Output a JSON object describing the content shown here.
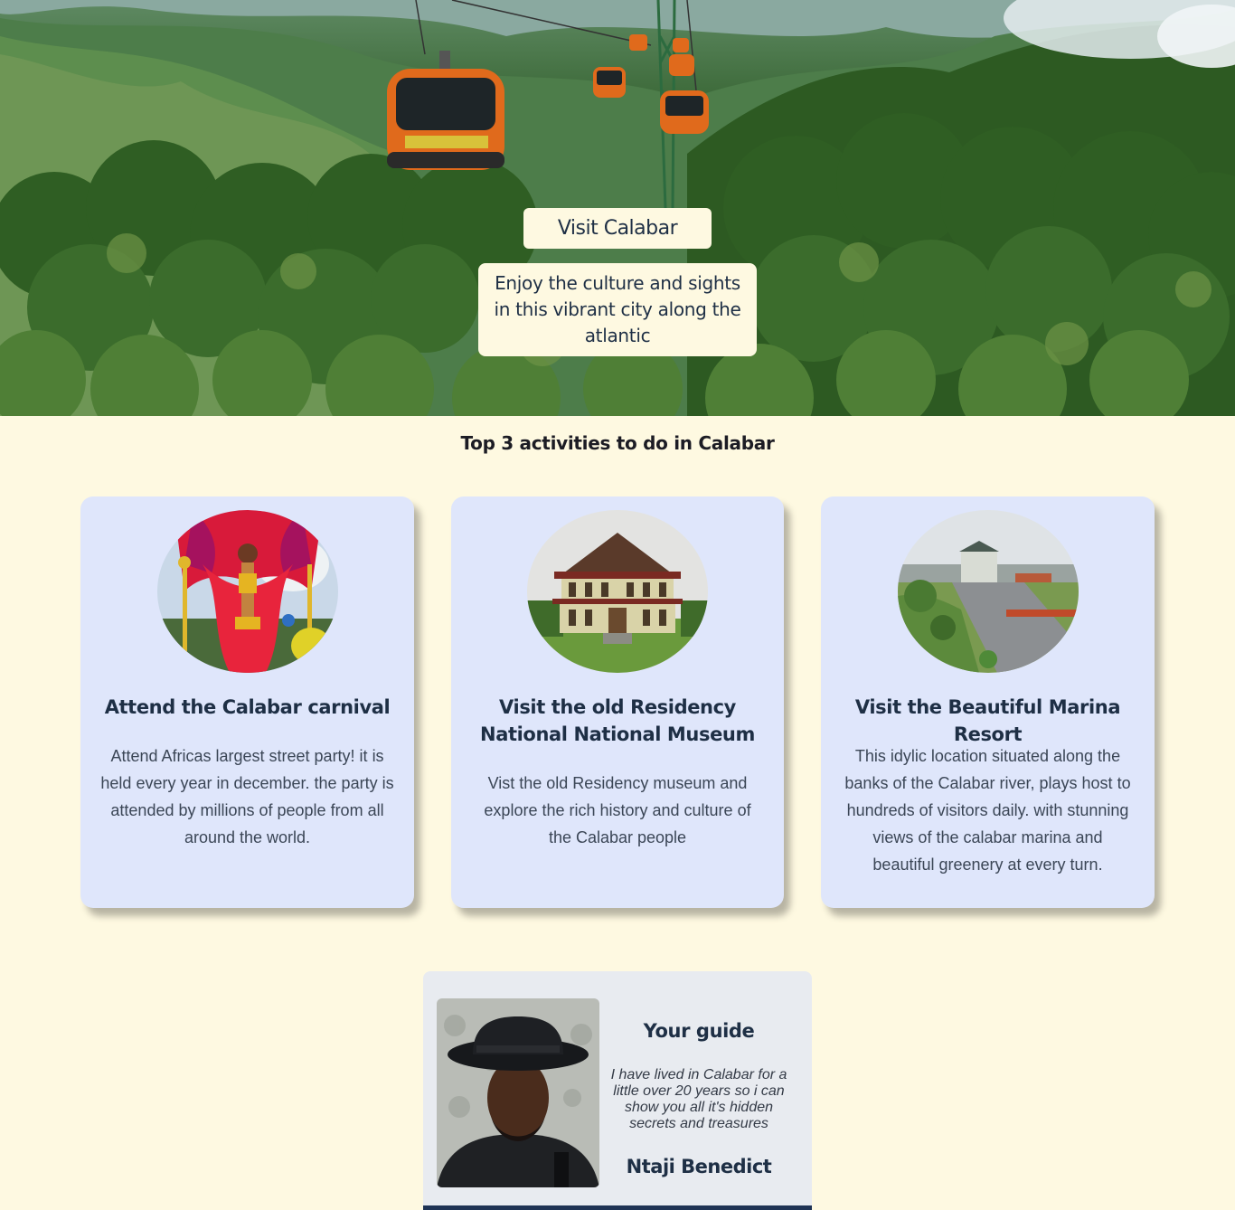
{
  "hero": {
    "title": "Visit Calabar",
    "subtitle": "Enjoy the culture and sights in this vibrant city along the atlantic",
    "image_icon": "cable-car-forest-image"
  },
  "activities": {
    "heading": "Top 3 activities to do in Calabar",
    "cards": [
      {
        "image_icon": "carnival-dancer-image",
        "title": "Attend the Calabar carnival",
        "text": "Attend Africas largest street party! it is held every year in december. the party is attended by millions of people from all around the world."
      },
      {
        "image_icon": "residency-museum-image",
        "title": "Visit the old Residency National National Museum",
        "text": "Vist the old Residency museum and explore the rich history and culture of the Calabar people"
      },
      {
        "image_icon": "marina-resort-image",
        "title": "Visit the Beautiful Marina Resort",
        "text": "This idylic location situated along the banks of the Calabar river, plays host to hundreds of visitors daily. with stunning views of the calabar marina and beautiful greenery at every turn."
      }
    ]
  },
  "guide": {
    "title": "Your guide",
    "quote": "I have lived in Calabar for a little over 20 years so i can show you all it's hidden secrets and treasures",
    "name": "Ntaji Benedict",
    "image_icon": "guide-portrait-image"
  },
  "colors": {
    "page_background": "#fef9e1",
    "card_background": "#dfe6fb",
    "guide_background": "#e8ebf0",
    "heading_text": "#1e2f45",
    "guide_accent_border": "#1e3354"
  }
}
